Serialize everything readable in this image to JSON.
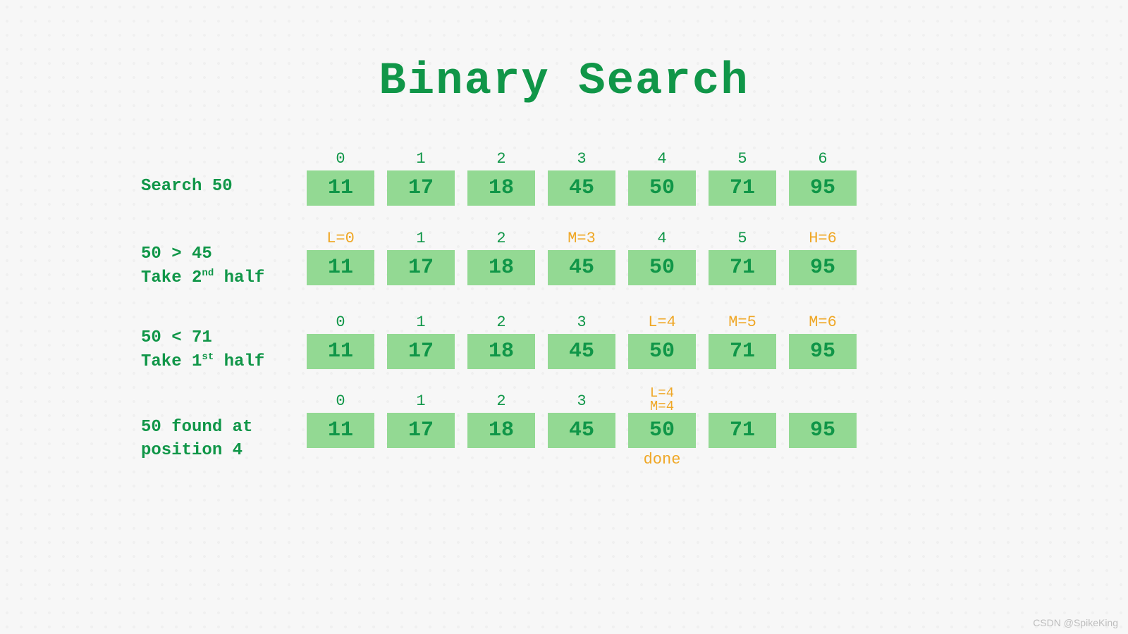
{
  "title": "Binary Search",
  "rows": [
    {
      "label_lines": [
        "Search 50"
      ],
      "cells": [
        {
          "idx": "0",
          "val": "11"
        },
        {
          "idx": "1",
          "val": "17"
        },
        {
          "idx": "2",
          "val": "18"
        },
        {
          "idx": "3",
          "val": "45"
        },
        {
          "idx": "4",
          "val": "50"
        },
        {
          "idx": "5",
          "val": "71"
        },
        {
          "idx": "6",
          "val": "95"
        }
      ]
    },
    {
      "label_lines": [
        "50 > 45",
        "Take 2",
        "nd",
        " half"
      ],
      "label_has_sup": true,
      "cells": [
        {
          "idx": "L=0",
          "val": "11",
          "hl": true
        },
        {
          "idx": "1",
          "val": "17"
        },
        {
          "idx": "2",
          "val": "18"
        },
        {
          "idx": "M=3",
          "val": "45",
          "hl": true
        },
        {
          "idx": "4",
          "val": "50"
        },
        {
          "idx": "5",
          "val": "71"
        },
        {
          "idx": "H=6",
          "val": "95",
          "hl": true
        }
      ]
    },
    {
      "label_lines": [
        "50 < 71",
        "Take 1",
        "st",
        " half"
      ],
      "label_has_sup": true,
      "cells": [
        {
          "idx": "0",
          "val": "11"
        },
        {
          "idx": "1",
          "val": "17"
        },
        {
          "idx": "2",
          "val": "18"
        },
        {
          "idx": "3",
          "val": "45"
        },
        {
          "idx": "L=4",
          "val": "50",
          "hl": true
        },
        {
          "idx": "M=5",
          "val": "71",
          "hl": true
        },
        {
          "idx": "M=6",
          "val": "95",
          "hl": true
        }
      ]
    },
    {
      "label_lines": [
        "50 found at",
        "position 4"
      ],
      "cells": [
        {
          "idx": "0",
          "val": "11"
        },
        {
          "idx": "1",
          "val": "17"
        },
        {
          "idx": "2",
          "val": "18"
        },
        {
          "idx": "3",
          "val": "45"
        },
        {
          "idx_lines": [
            "L=4",
            "M=4"
          ],
          "val": "50",
          "hl": true,
          "below": "done"
        },
        {
          "idx": "",
          "val": "71"
        },
        {
          "idx": "",
          "val": "95"
        }
      ]
    }
  ],
  "watermark": "CSDN @SpikeKing"
}
